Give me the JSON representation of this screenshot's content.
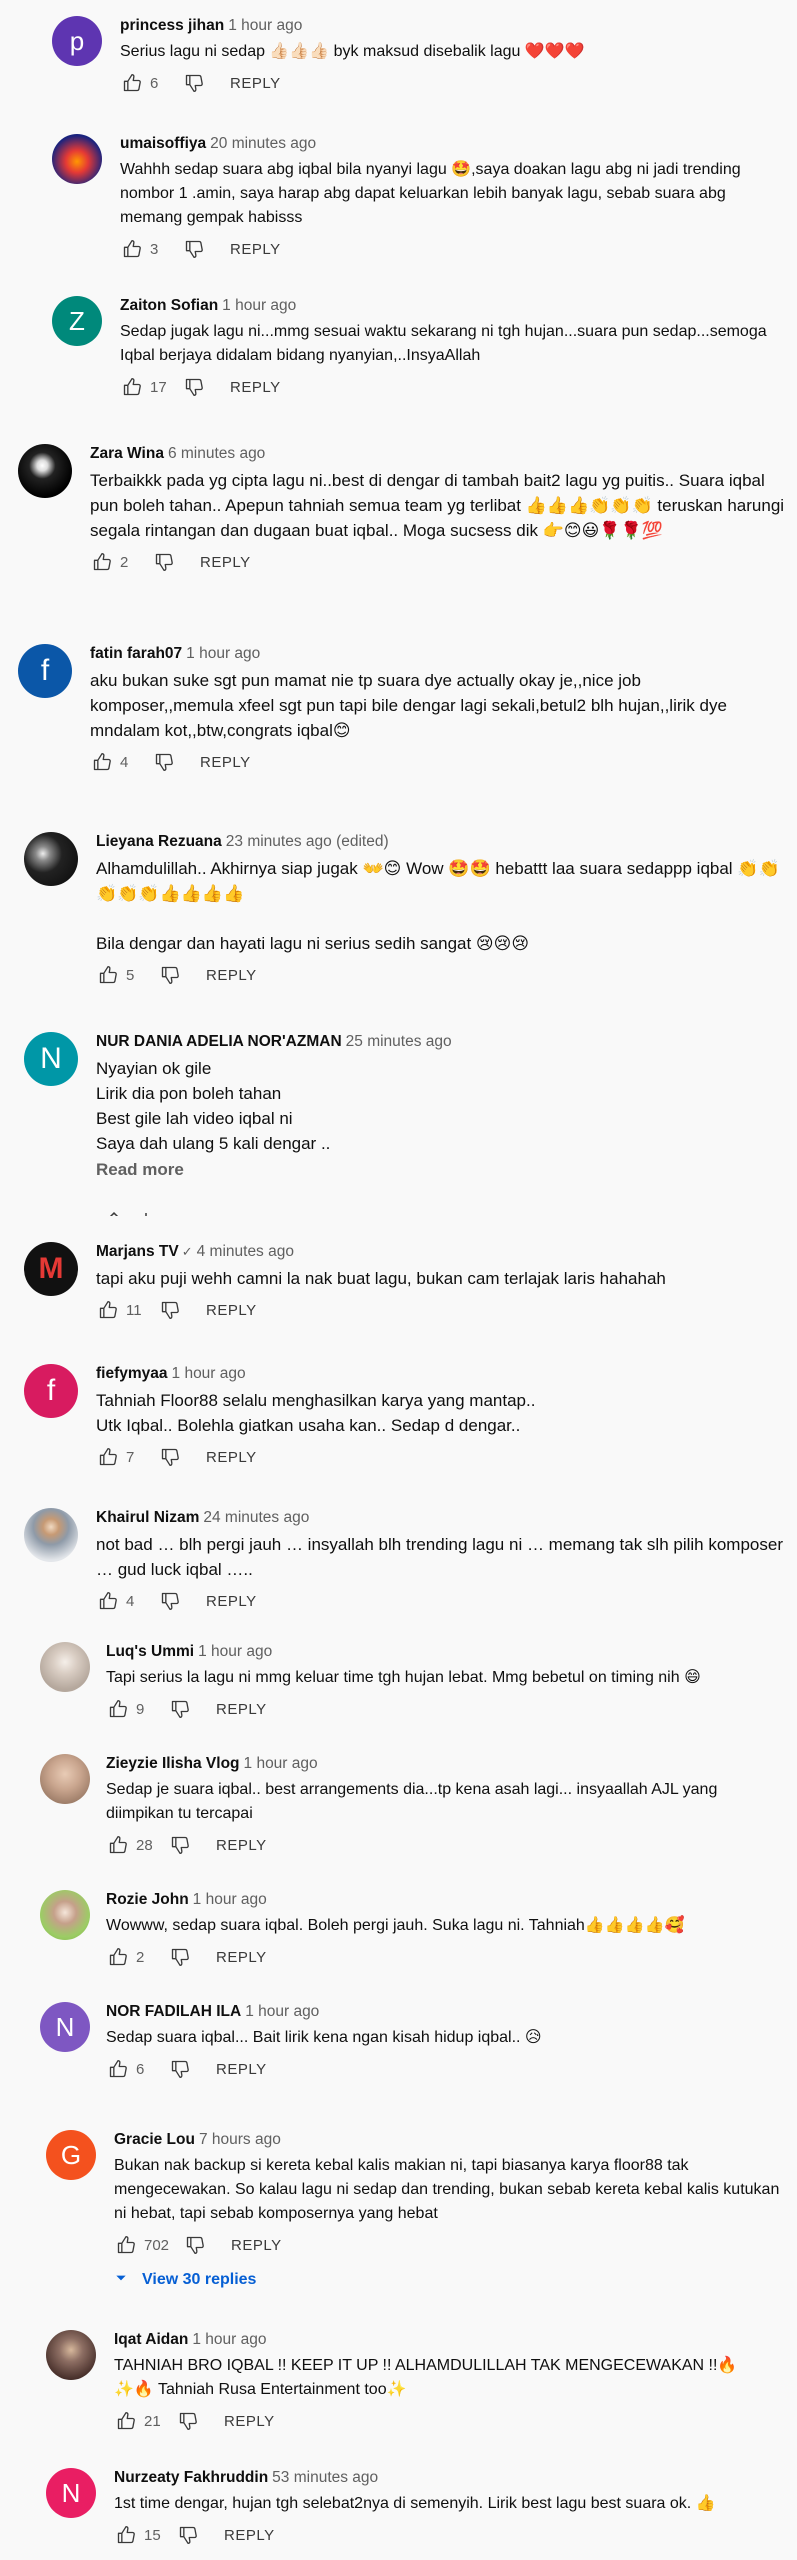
{
  "ui": {
    "reply_label": "REPLY",
    "read_more": "Read more",
    "view_replies": "View 30 replies"
  },
  "comments": [
    {
      "author": "princess jihan",
      "time": "1 hour ago",
      "text": "Serius lagu ni sedap 👍🏻👍🏻👍🏻 byk maksud disebalik lagu ❤️❤️❤️",
      "likes": "6",
      "avatar_letter": "p",
      "avatar_color": "#5e35b1"
    },
    {
      "author": "umaisoffiya",
      "time": "20 minutes ago",
      "text": "Wahhh sedap suara abg iqbal bila nyanyi lagu 🤩,saya doakan lagu abg ni jadi trending nombor 1 .amin, saya harap abg dapat keluarkan lebih banyak lagu, sebab suara abg memang gempak habisss",
      "likes": "3",
      "avatar_letter": "",
      "avatar_color": "#1a237e"
    },
    {
      "author": "Zaiton Sofian",
      "time": "1 hour ago",
      "text": "Sedap jugak lagu ni...mmg sesuai waktu sekarang ni tgh hujan...suara pun sedap...semoga Iqbal berjaya didalam bidang nyanyian,..InsyaAllah",
      "likes": "17",
      "avatar_letter": "Z",
      "avatar_color": "#00897b"
    },
    {
      "author": "Zara Wina",
      "time": "6 minutes ago",
      "text": "Terbaikkk pada yg cipta lagu ni..best di dengar di tambah bait2 lagu yg puitis.. Suara iqbal pun boleh tahan.. Apepun tahniah semua team yg terlibat 👍👍👍👏👏👏 teruskan harungi  segala rintangan dan dugaan buat iqbal.. Moga sucsess dik 👉😊😃🌹🌹💯",
      "likes": "2",
      "avatar_letter": "",
      "avatar_color": "#000000"
    },
    {
      "author": "fatin farah07",
      "time": "1 hour ago",
      "text": "aku bukan suke sgt pun mamat nie tp suara dye actually okay je,,nice job komposer,,memula xfeel sgt pun tapi bile dengar lagi sekali,betul2 blh hujan,,lirik dye mndalam kot,,btw,congrats iqbal😊",
      "likes": "4",
      "avatar_letter": "f",
      "avatar_color": "#0b57a8"
    },
    {
      "author": "Lieyana Rezuana",
      "time": "23 minutes ago (edited)",
      "text": "Alhamdulillah.. Akhirnya siap jugak 👐😊 Wow 🤩🤩 hebattt laa suara sedappp iqbal 👏👏👏👏👏👍👍👍👍\n\nBila dengar dan hayati lagu ni serius sedih sangat 😢😢😢",
      "likes": "5",
      "avatar_letter": "",
      "avatar_color": "#2b2b2b"
    },
    {
      "author": "NUR DANIA ADELIA NOR'AZMAN",
      "time": "25 minutes ago",
      "text": "Nyayian ok gile\nLirik dia pon boleh tahan\nBest gile lah video iqbal ni\nSaya dah ulang 5 kali dengar ..",
      "likes": "",
      "avatar_letter": "N",
      "avatar_color": "#0097a7"
    },
    {
      "author": "Marjans TV",
      "time": "4 minutes ago",
      "text": "tapi aku puji wehh camni la nak buat lagu, bukan cam terlajak laris hahahah",
      "likes": "11",
      "avatar_letter": "M",
      "avatar_color": "#111111",
      "verified": "✓"
    },
    {
      "author": "fiefymyaa",
      "time": "1 hour ago",
      "text": "Tahniah Floor88 selalu menghasilkan karya yang mantap..\nUtk Iqbal.. Bolehla giatkan usaha kan.. Sedap d dengar..",
      "likes": "7",
      "avatar_letter": "f",
      "avatar_color": "#d81b60"
    },
    {
      "author": "Khairul Nizam",
      "time": "24 minutes ago",
      "text": "not bad … blh pergi jauh … insyallah blh trending lagu ni … memang tak slh pilih komposer … gud luck iqbal …..",
      "likes": "4",
      "avatar_letter": "",
      "avatar_color": "#6d7b8d"
    },
    {
      "author": "Luq's Ummi",
      "time": "1 hour ago",
      "text": "Tapi serius la lagu ni mmg keluar time tgh hujan lebat. Mmg bebetul on timing nih 😄",
      "likes": "9",
      "avatar_letter": "",
      "avatar_color": "#cfc6bf"
    },
    {
      "author": "Zieyzie Ilisha Vlog",
      "time": "1 hour ago",
      "text": "Sedap je suara iqbal.. best arrangements dia...tp kena asah lagi... insyaallah AJL yang diimpikan tu tercapai",
      "likes": "28",
      "avatar_letter": "",
      "avatar_color": "#c9a58e"
    },
    {
      "author": "Rozie John",
      "time": "1 hour ago",
      "text": "Wowww, sedap suara iqbal. Boleh pergi jauh. Suka lagu ni. Tahniah👍👍👍👍🥰",
      "likes": "2",
      "avatar_letter": "",
      "avatar_color": "#9ccc65"
    },
    {
      "author": "NOR FADILAH ILA",
      "time": "1 hour ago",
      "text": "Sedap suara iqbal... Bait lirik kena ngan kisah hidup iqbal.. 😥",
      "likes": "6",
      "avatar_letter": "N",
      "avatar_color": "#7e57c2"
    },
    {
      "author": "Gracie Lou",
      "time": "7 hours ago",
      "text": "Bukan nak backup si kereta kebal kalis makian ni, tapi biasanya karya floor88 tak mengecewakan. So kalau lagu ni sedap dan trending, bukan sebab kereta kebal kalis kutukan ni hebat, tapi sebab komposernya yang hebat",
      "likes": "702",
      "avatar_letter": "G",
      "avatar_color": "#f4511e"
    },
    {
      "author": "Iqat Aidan",
      "time": "1 hour ago",
      "text": "TAHNIAH BRO IQBAL !! KEEP IT UP !! ALHAMDULILLAH TAK MENGECEWAKAN !!🔥\n✨🔥 Tahniah Rusa Entertainment too✨",
      "likes": "21",
      "avatar_letter": "",
      "avatar_color": "#5d4037"
    },
    {
      "author": "Nurzeaty Fakhruddin",
      "time": "53 minutes ago",
      "text": "1st time dengar, hujan tgh selebat2nya di semenyih. Lirik best lagu best suara ok. 👍",
      "likes": "15",
      "avatar_letter": "N",
      "avatar_color": "#e91e63"
    }
  ]
}
